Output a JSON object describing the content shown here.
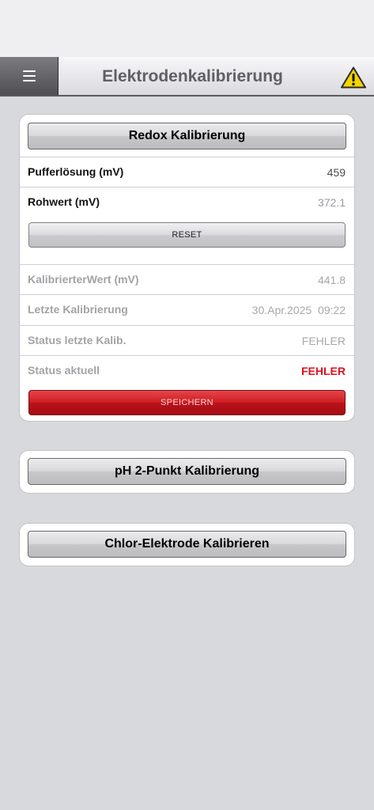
{
  "header": {
    "title": "Elektrodenkalibrierung",
    "menu_icon": "hamburger-menu-icon",
    "warning_icon": "warning-triangle-icon",
    "warning_color": "#f5d400"
  },
  "redox": {
    "header_label": "Redox Kalibrierung",
    "buffer_label": "Pufferlösung (mV)",
    "buffer_value": "459",
    "raw_label": "Rohwert (mV)",
    "raw_value": "372.1",
    "reset_label": "RESET",
    "calibrated_label": "KalibrierterWert (mV)",
    "calibrated_value": "441.8",
    "last_cal_label": "Letzte Kalibrierung",
    "last_cal_value": "30.Apr.2025  09:22",
    "status_last_label": "Status letzte Kalib.",
    "status_last_value": "FEHLER",
    "status_current_label": "Status aktuell",
    "status_current_value": "FEHLER",
    "save_label": "SPEICHERN",
    "error_color": "#e0101c",
    "save_color": "#c4151c"
  },
  "ph": {
    "header_label": "pH 2-Punkt Kalibrierung"
  },
  "chlor": {
    "header_label": "Chlor-Elektrode Kalibrieren"
  }
}
